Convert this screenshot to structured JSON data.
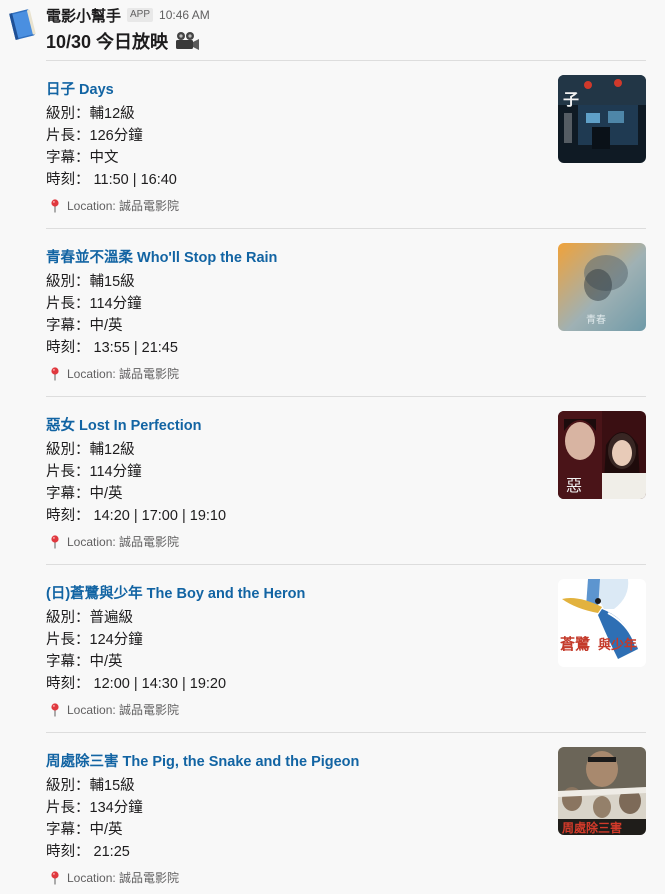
{
  "bot": {
    "name": "電影小幫手",
    "badge": "APP",
    "time": "10:46 AM"
  },
  "message": {
    "title": "10/30 今日放映",
    "emoji_icon": "movie-camera-icon"
  },
  "labels": {
    "rating": "級別：",
    "length": "片長：",
    "subtitle": "字幕：",
    "times": "時刻： "
  },
  "movies": [
    {
      "title": "日子 Days",
      "rating": "輔12級",
      "length": "126分鐘",
      "subtitle": "中文",
      "times": "11:50 | 16:40",
      "location": "Location: 誠品電影院"
    },
    {
      "title": "青春並不溫柔 Who'll Stop the Rain",
      "rating": "輔15級",
      "length": "114分鐘",
      "subtitle": "中/英",
      "times": "13:55 | 21:45",
      "location": "Location: 誠品電影院"
    },
    {
      "title": "惡女 Lost In Perfection",
      "rating": "輔12級",
      "length": "114分鐘",
      "subtitle": "中/英",
      "times": "14:20 | 17:00 | 19:10",
      "location": "Location: 誠品電影院"
    },
    {
      "title": "(日)蒼鷺與少年 The Boy and the Heron",
      "rating": "普遍級",
      "length": "124分鐘",
      "subtitle": "中/英",
      "times": "12:00 | 14:30 | 19:20",
      "location": "Location: 誠品電影院"
    },
    {
      "title": "周處除三害 The Pig, the Snake and the Pigeon",
      "rating": "輔15級",
      "length": "134分鐘",
      "subtitle": "中/英",
      "times": "21:25",
      "location": "Location: 誠品電影院"
    }
  ],
  "colors": {
    "link": "#1264a3",
    "text": "#1d1c1d",
    "muted": "#616061",
    "background": "#f8f8f8"
  }
}
